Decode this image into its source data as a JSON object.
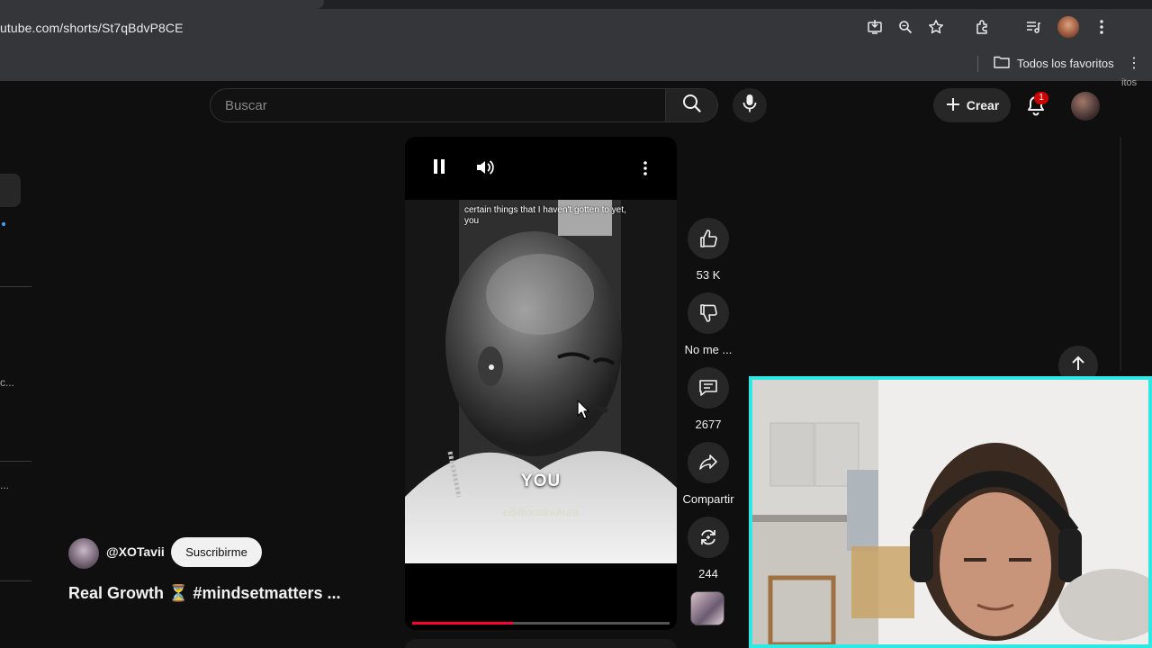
{
  "browser": {
    "url": "utube.com/shorts/St7qBdvP8CE",
    "bookmarks_all": "Todos los favoritos",
    "edge_fragment": "itos"
  },
  "header": {
    "search_placeholder": "Buscar",
    "create_label": "Crear",
    "notification_count": "1"
  },
  "sidebar_fragments": [
    "c...",
    "..."
  ],
  "short": {
    "caption_top": "certain things that I haven't gotten to yet, you",
    "caption_word": "YOU",
    "watermark": "eBillionaireAura",
    "progress": 0.39
  },
  "actions": {
    "like_count": "53 K",
    "dislike_label": "No me ...",
    "comment_count": "2677",
    "share_label": "Compartir",
    "remix_count": "244"
  },
  "channel": {
    "handle": "@XOTavii",
    "subscribe_label": "Suscribirme",
    "title": "Real Growth ⏳ #mindsetmatters ..."
  },
  "colors": {
    "accent_red": "#ff0033",
    "webcam_border": "#2ee8e4",
    "badge_red": "#cc0000"
  }
}
